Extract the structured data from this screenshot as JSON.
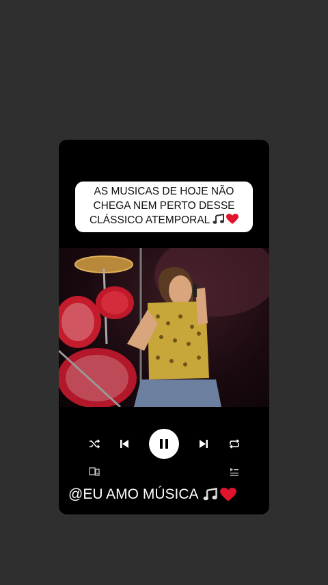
{
  "caption": {
    "lines": [
      "AS MUSICAS DE HOJE NÃO",
      "CHEGA NEM PERTO DESSE",
      "CLÁSSICO ATEMPORAL"
    ],
    "emoji": "🎵❤️"
  },
  "player": {
    "state": "playing",
    "icons": {
      "shuffle": "shuffle-icon",
      "previous": "skip-previous-icon",
      "pause": "pause-icon",
      "next": "skip-next-icon",
      "repeat": "repeat-icon",
      "devices": "connect-device-icon",
      "queue": "queue-icon"
    }
  },
  "watermark": {
    "text": "@EU AMO MÚSICA",
    "emoji": "🎵❤️"
  },
  "colors": {
    "background": "#2f2f2f",
    "card": "#000000",
    "caption_bg": "#ffffff",
    "heart": "#e0142c"
  }
}
